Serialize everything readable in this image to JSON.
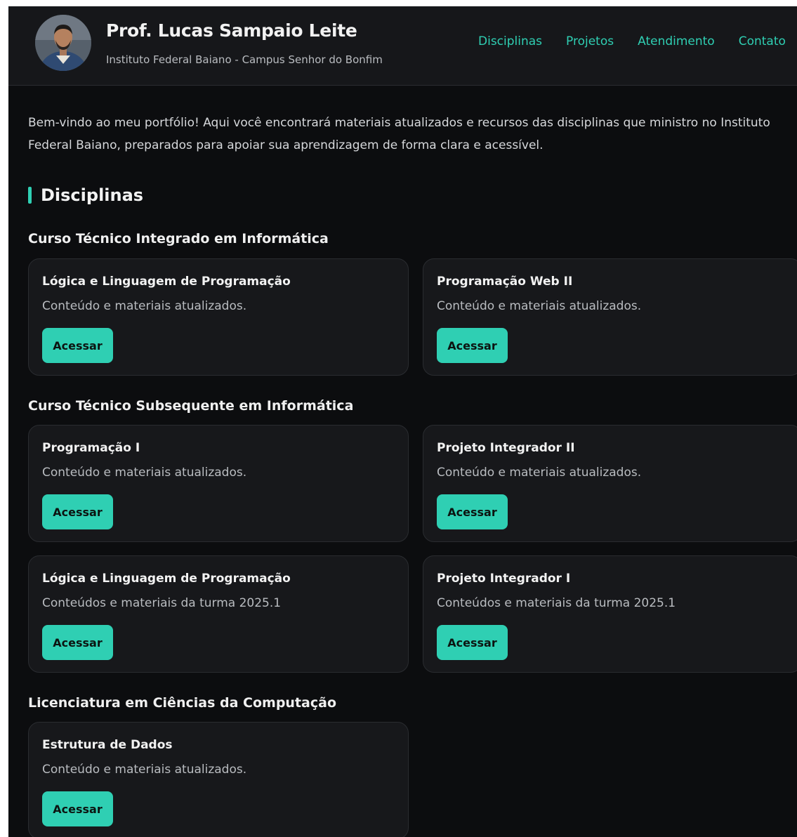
{
  "header": {
    "name": "Prof. Lucas Sampaio Leite",
    "institution": "Instituto Federal Baiano - Campus Senhor do Bonfim",
    "nav": [
      "Disciplinas",
      "Projetos",
      "Atendimento",
      "Contato"
    ]
  },
  "intro": "Bem-vindo ao meu portfólio! Aqui você encontrará materiais atualizados e recursos das disciplinas que ministro no Instituto Federal Baiano, preparados para apoiar sua aprendizagem de forma clara e acessível.",
  "section": {
    "title": "Disciplinas"
  },
  "accent_color": "#2fcfb3",
  "courses": [
    {
      "title": "Curso Técnico Integrado em Informática",
      "cards": [
        {
          "title": "Lógica e Linguagem de Programação",
          "desc": "Conteúdo e materiais atualizados.",
          "button": "Acessar"
        },
        {
          "title": "Programação Web II",
          "desc": "Conteúdo e materiais atualizados.",
          "button": "Acessar"
        }
      ]
    },
    {
      "title": "Curso Técnico Subsequente em Informática",
      "cards": [
        {
          "title": "Programação I",
          "desc": "Conteúdo e materiais atualizados.",
          "button": "Acessar"
        },
        {
          "title": "Projeto Integrador II",
          "desc": "Conteúdo e materiais atualizados.",
          "button": "Acessar"
        },
        {
          "title": "Lógica e Linguagem de Programação",
          "desc": "Conteúdos e materiais da turma 2025.1",
          "button": "Acessar"
        },
        {
          "title": "Projeto Integrador I",
          "desc": "Conteúdos e materiais da turma 2025.1",
          "button": "Acessar"
        }
      ]
    },
    {
      "title": "Licenciatura em Ciências da Computação",
      "cards": [
        {
          "title": "Estrutura de Dados",
          "desc": "Conteúdo e materiais atualizados.",
          "button": "Acessar"
        }
      ]
    }
  ]
}
